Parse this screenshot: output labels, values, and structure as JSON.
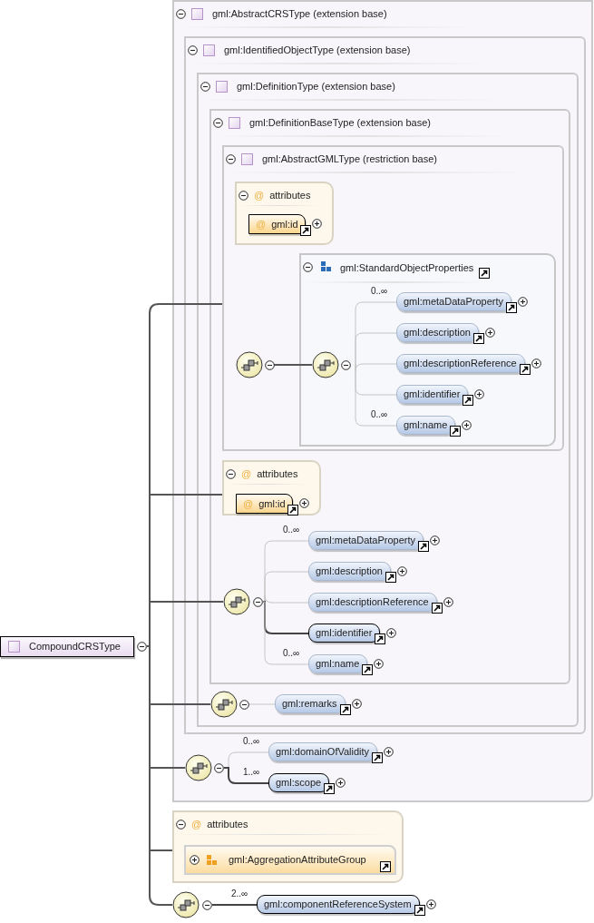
{
  "root": {
    "name": "CompoundCRSType",
    "expanded": true
  },
  "base_types": [
    {
      "label": "gml:AbstractCRSType (extension base)",
      "expanded": true
    },
    {
      "label": "gml:IdentifiedObjectType (extension base)",
      "expanded": true
    },
    {
      "label": "gml:DefinitionType (extension base)",
      "expanded": true
    },
    {
      "label": "gml:DefinitionBaseType (extension base)",
      "expanded": true
    },
    {
      "label": "gml:AbstractGMLType (restriction base)",
      "expanded": true
    }
  ],
  "id_attributes": [
    {
      "label": "attributes",
      "symbol": "@",
      "expanded": true,
      "attribute": {
        "symbol": "@",
        "name": "gml:id",
        "expanded": false
      }
    },
    {
      "label": "attributes",
      "symbol": "@",
      "expanded": true,
      "attribute": {
        "symbol": "@",
        "name": "gml:id",
        "expanded": false
      }
    }
  ],
  "standard_object_properties": {
    "name": "gml:StandardObjectProperties",
    "expanded": true,
    "outer_sequence_expanded": true,
    "sequence_expanded": true,
    "elements": [
      {
        "name": "gml:metaDataProperty",
        "occurs": "0..∞",
        "required": false,
        "expanded": false
      },
      {
        "name": "gml:description",
        "required": false,
        "expanded": false
      },
      {
        "name": "gml:descriptionReference",
        "required": false,
        "expanded": false
      },
      {
        "name": "gml:identifier",
        "required": false,
        "expanded": false
      },
      {
        "name": "gml:name",
        "occurs": "0..∞",
        "required": false,
        "expanded": false
      }
    ]
  },
  "sequences": [
    {
      "expanded": true,
      "elements": [
        {
          "name": "gml:metaDataProperty",
          "occurs": "0..∞",
          "required": false,
          "expanded": false
        },
        {
          "name": "gml:description",
          "required": false,
          "expanded": false
        },
        {
          "name": "gml:descriptionReference",
          "required": false,
          "expanded": false
        },
        {
          "name": "gml:identifier",
          "required": true,
          "expanded": false
        },
        {
          "name": "gml:name",
          "occurs": "0..∞",
          "required": false,
          "expanded": false
        }
      ]
    },
    {
      "expanded": true,
      "elements": [
        {
          "name": "gml:remarks",
          "required": false,
          "expanded": false
        }
      ]
    },
    {
      "expanded": true,
      "elements": [
        {
          "name": "gml:domainOfValidity",
          "occurs": "0..∞",
          "required": false,
          "expanded": false
        },
        {
          "name": "gml:scope",
          "occurs": "1..∞",
          "required": true,
          "expanded": false
        }
      ]
    },
    {
      "expanded": true,
      "elements": [
        {
          "name": "gml:componentReferenceSystem",
          "occurs": "2..∞",
          "required": true,
          "expanded": false
        }
      ]
    }
  ],
  "aggregation_attributes": {
    "label": "attributes",
    "symbol": "@",
    "expanded": true,
    "group": {
      "name": "gml:AggregationAttributeGroup",
      "expanded": false
    }
  }
}
